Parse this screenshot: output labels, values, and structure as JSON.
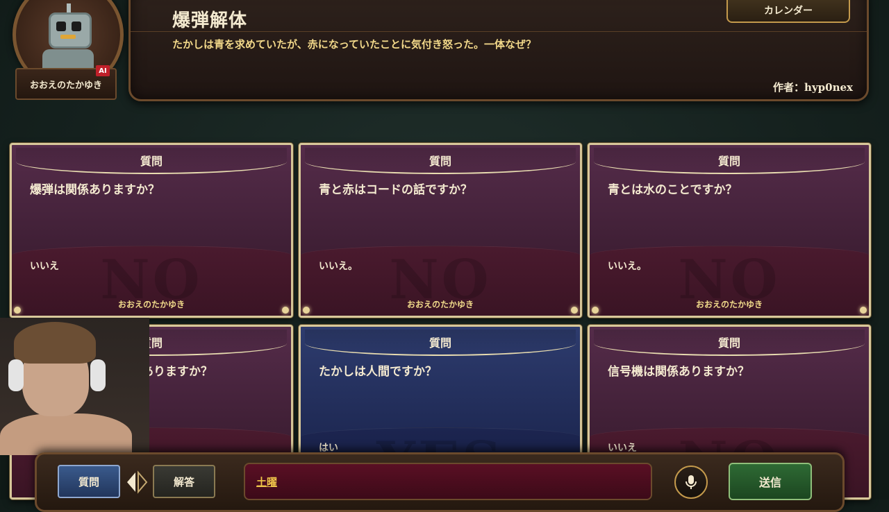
{
  "header": {
    "puzzle_title": "爆弾解体",
    "puzzle_text": "たかしは青を求めていたが、赤になっていたことに気付き怒った。一体なぜ？",
    "author": "作者：hyp0nex",
    "calendar_label": "カレンダー"
  },
  "avatar": {
    "name": "おおえのたかゆき",
    "badge": "AI"
  },
  "cards": [
    {
      "header": "質問",
      "question": "爆弾は関係ありますか？",
      "answer": "いいえ",
      "watermark": "NO",
      "responder": "おおえのたかゆき",
      "color": "#4a1f3a"
    },
    {
      "header": "質問",
      "question": "青と赤はコードの話ですか？",
      "answer": "いいえ。",
      "watermark": "NO",
      "responder": "おおえのたかゆき",
      "color": "#4a1f3a"
    },
    {
      "header": "質問",
      "question": "青とは水のことですか？",
      "answer": "いいえ。",
      "watermark": "NO",
      "responder": "おおえのたかゆき",
      "color": "#4a1f3a"
    },
    {
      "header": "質問",
      "question": "は関係ありますか？",
      "answer": "",
      "watermark": "",
      "responder": "",
      "color": "#4a1f3a"
    },
    {
      "header": "質問",
      "question": "たかしは人間ですか？",
      "answer": "はい",
      "watermark": "YES",
      "responder": "",
      "color": "#1f2a55"
    },
    {
      "header": "質問",
      "question": "信号機は関係ありますか？",
      "answer": "いいえ",
      "watermark": "NO",
      "responder": "",
      "color": "#4a1f3a"
    }
  ],
  "bottom": {
    "question_mode": "質問",
    "answer_mode": "解答",
    "input_value": "土曜",
    "send_label": "送信",
    "mic_icon": "microphone-icon"
  }
}
